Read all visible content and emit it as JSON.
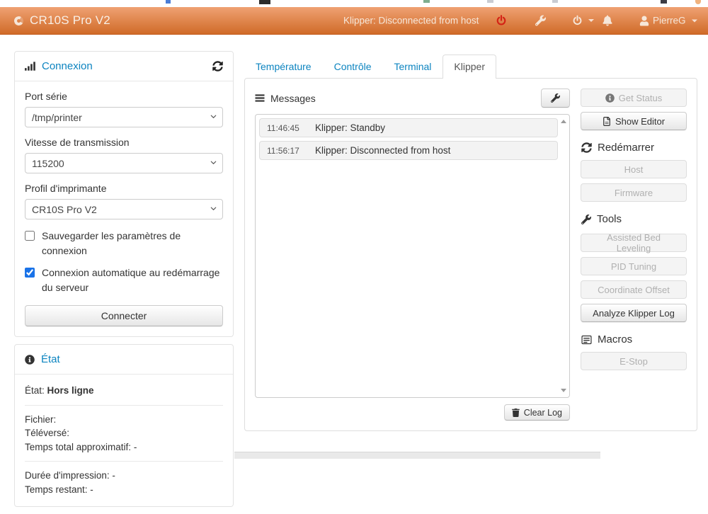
{
  "navbar": {
    "title": "CR10S Pro V2",
    "status": "Klipper: Disconnected from host",
    "user": "PierreG"
  },
  "sidebar": {
    "connection": {
      "title": "Connexion",
      "port_label": "Port série",
      "port_value": "/tmp/printer",
      "baud_label": "Vitesse de transmission",
      "baud_value": "115200",
      "profile_label": "Profil d'imprimante",
      "profile_value": "CR10S Pro V2",
      "save_settings_label": "Sauvegarder les paramètres de connexion",
      "autoconnect_label": "Connexion automatique au redémarrage du serveur",
      "autoconnect_checked": true,
      "connect_button": "Connecter"
    },
    "state": {
      "title": "État",
      "state_label": "État:",
      "state_value": "Hors ligne",
      "file_line": "Fichier:",
      "uploaded_line": "Téléversé:",
      "total_time_line": "Temps total approximatif: -",
      "print_time_line": "Durée d'impression: -",
      "time_left_line": "Temps restant: -"
    }
  },
  "tabs": [
    {
      "label": "Température"
    },
    {
      "label": "Contrôle"
    },
    {
      "label": "Terminal"
    },
    {
      "label": "Klipper"
    }
  ],
  "klipper": {
    "messages_title": "Messages",
    "log": [
      {
        "time": "11:46:45",
        "message": "Klipper: Standby"
      },
      {
        "time": "11:56:17",
        "message": "Klipper: Disconnected from host"
      }
    ],
    "clear_log_button": "Clear Log",
    "controls": {
      "get_status": "Get Status",
      "show_editor": "Show Editor",
      "restart_heading": "Redémarrer",
      "host": "Host",
      "firmware": "Firmware",
      "tools_heading": "Tools",
      "assisted_bed_leveling": "Assisted Bed Leveling",
      "pid_tuning": "PID Tuning",
      "coordinate_offset": "Coordinate Offset",
      "analyze_log": "Analyze Klipper Log",
      "macros_heading": "Macros",
      "estop": "E-Stop"
    }
  },
  "colors": {
    "navbar_top": "#efa173",
    "navbar_bottom": "#d06b28",
    "link": "#0c84c0",
    "danger": "#d42315"
  }
}
